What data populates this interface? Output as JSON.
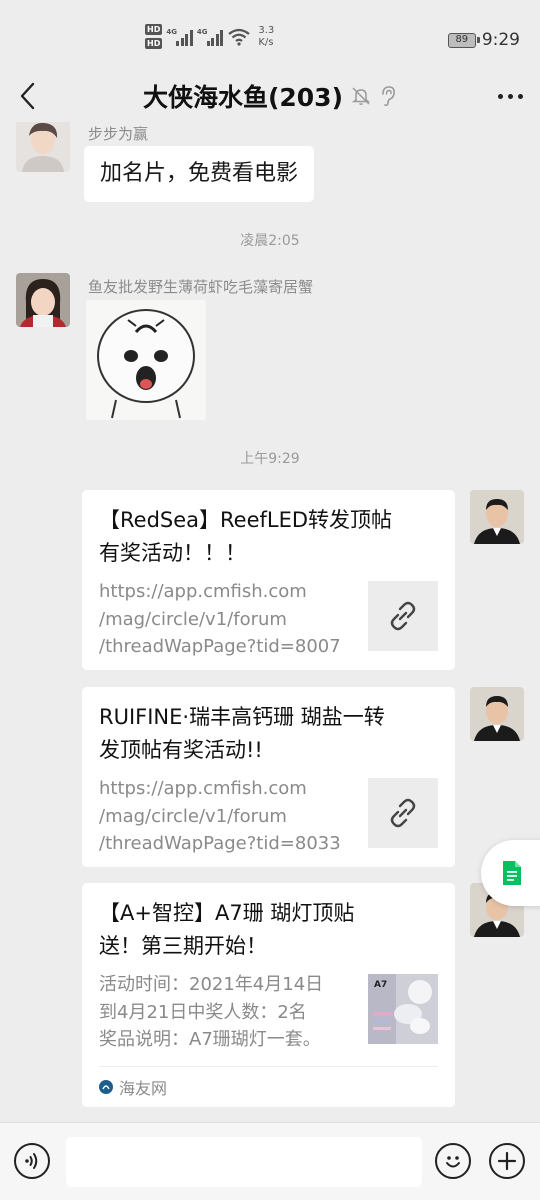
{
  "status_bar": {
    "hd1": "HD",
    "hd2": "HD",
    "net1": "4G",
    "net2": "4G",
    "speed_value": "3.3",
    "speed_unit": "K/s",
    "battery": "89",
    "time": "9:29",
    "icons": [
      "hd-icon",
      "signal-icon",
      "wifi-icon",
      "battery-icon"
    ]
  },
  "header": {
    "title": "大侠海水鱼(203)",
    "icons": [
      "back-arrow-icon",
      "mute-bell-icon",
      "ear-icon",
      "more-icon"
    ]
  },
  "chat": {
    "messages": [
      {
        "sender": "步步为赢",
        "text": "加名片，免费看电影"
      },
      {
        "time": "凌晨2:05"
      },
      {
        "sender": "鱼友批发野生薄荷虾吃毛藻寄居蟹",
        "type": "sticker"
      },
      {
        "time": "上午9:29"
      }
    ],
    "cards": [
      {
        "title_line1": "【RedSea】ReefLED转发顶帖",
        "title_line2": "有奖活动！！！",
        "desc_line1": "https://app.cmfish.com",
        "desc_line2": "/mag/circle/v1/forum",
        "desc_line3": "/threadWapPage?tid=8007",
        "thumb": "link-icon"
      },
      {
        "title_line1": "RUIFINE·瑞丰高钙珊 瑚盐一转",
        "title_line2": "发顶帖有奖活动!!",
        "desc_line1": "https://app.cmfish.com",
        "desc_line2": "/mag/circle/v1/forum",
        "desc_line3": "/threadWapPage?tid=8033",
        "thumb": "link-icon"
      },
      {
        "title_line1": "【A+智控】A7珊 瑚灯顶贴",
        "title_line2": "送！第三期开始！",
        "desc_line1": "活动时间：2021年4月14日",
        "desc_line2": "到4月21日中奖人数：2名",
        "desc_line3": "奖品说明：A7珊瑚灯一套。",
        "thumb_label": "A7",
        "source": "海友网"
      }
    ]
  },
  "input_bar": {
    "placeholder": "",
    "icons": [
      "voice-icon",
      "emoji-icon",
      "plus-icon"
    ]
  },
  "floating": {
    "icon": "document-icon"
  },
  "colors": {
    "chat_bg": "#ededed",
    "bubble_bg": "#ffffff",
    "timestamp": "#9a9a9a",
    "doc_green": "#07c160",
    "source_blue": "#1f5d8a"
  }
}
